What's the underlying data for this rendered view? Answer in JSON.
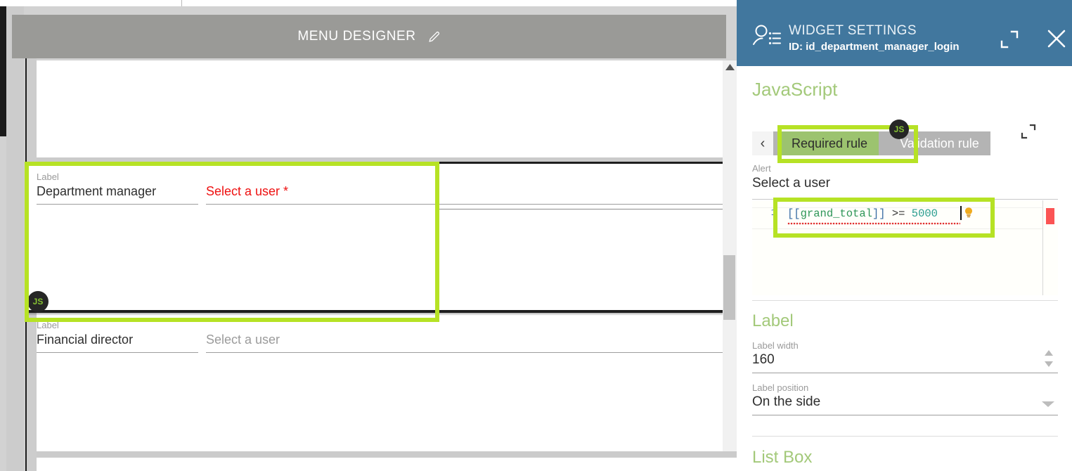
{
  "designer": {
    "title": "MENU DESIGNER",
    "edit_icon": "pencil-icon",
    "fields": [
      {
        "label_caption": "Label",
        "label_value": "Department manager",
        "input_value": "Select a user *",
        "state": "required-error",
        "badge": "JS"
      },
      {
        "label_caption": "Label",
        "label_value": "Financial director",
        "input_value": "Select a user",
        "state": "placeholder",
        "badge": null
      }
    ]
  },
  "panel": {
    "icon": "contact-list-icon",
    "title": "WIDGET SETTINGS",
    "id_label": "ID: id_department_manager_login",
    "expand_icon": "expand-icon",
    "close_icon": "close-icon",
    "sections": {
      "javascript": {
        "title": "JavaScript",
        "prev_icon": "chevron-left-icon",
        "expand_icon": "expand-icon",
        "badge": "JS",
        "tabs": [
          {
            "label": "Required rule",
            "active": true
          },
          {
            "label": "Validation rule",
            "active": false
          }
        ],
        "alert_caption": "Alert",
        "alert_value": "Select a user",
        "editor": {
          "line_number": "1",
          "code_tokens": [
            {
              "text": "[[",
              "type": "bracket"
            },
            {
              "text": "grand_total",
              "type": "variable"
            },
            {
              "text": "]]",
              "type": "bracket"
            },
            {
              "text": " >= ",
              "type": "operator"
            },
            {
              "text": "5000",
              "type": "number"
            }
          ],
          "code_plain": "[[grand_total]] >= 5000",
          "hint_icon": "lightbulb-icon",
          "error_marker": "error-marker"
        }
      },
      "label": {
        "title": "Label",
        "width_caption": "Label width",
        "width_value": "160",
        "stepper_icon": "spinner-icon",
        "position_caption": "Label position",
        "position_value": "On the side",
        "position_caret_icon": "chevron-down-icon"
      },
      "listbox": {
        "title": "List Box"
      }
    }
  },
  "colors": {
    "panel_header": "#41779e",
    "accent_green": "#a3c97a",
    "annotation": "#b6e225",
    "tab_active": "#9cc36f",
    "tab_inactive": "#b4b4b4",
    "error_red": "#ee1111",
    "designer_bar": "#9a9a97"
  }
}
